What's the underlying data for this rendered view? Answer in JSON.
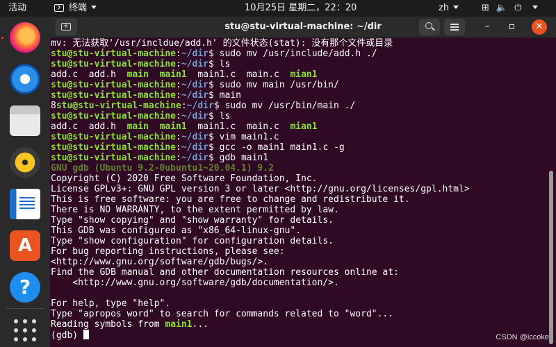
{
  "topbar": {
    "activities": "活动",
    "app_menu": "终端",
    "clock": "10月25日 星期二，22：20",
    "language": "zh",
    "icons": [
      "network-icon",
      "volume-icon",
      "power-icon"
    ]
  },
  "dock": {
    "apps": [
      "firefox",
      "thunderbird",
      "files",
      "rhythmbox",
      "libreoffice-writer",
      "ubuntu-software",
      "help",
      "show-applications"
    ],
    "software_glyph": "A",
    "help_glyph": "?"
  },
  "window": {
    "title": "stu@stu-virtual-machine: ~/dir",
    "new_tab": "+",
    "minimize": "–",
    "close": "✕"
  },
  "terminal": {
    "user_host": "stu@stu-virtual-machine",
    "colon": ":",
    "path": "~/dir",
    "lines": [
      {
        "type": "out",
        "text": "mv: 无法获取'/usr/incldue/add.h' 的文件状态(stat): 没有那个文件或目录"
      },
      {
        "type": "cmd",
        "pre": "",
        "cmd": " sudo mv /usr/include/add.h ./"
      },
      {
        "type": "cmd",
        "pre": "",
        "cmd": " ls"
      },
      {
        "type": "ls",
        "files": [
          {
            "t": "add.c",
            "x": false
          },
          {
            "t": "add.h",
            "x": false
          },
          {
            "t": "main",
            "x": true
          },
          {
            "t": "main1",
            "x": true
          },
          {
            "t": "main1.c",
            "x": false
          },
          {
            "t": "main.c",
            "x": false
          },
          {
            "t": "mian1",
            "x": true
          }
        ]
      },
      {
        "type": "cmd",
        "pre": "",
        "cmd": " sudo mv main /usr/bin/"
      },
      {
        "type": "cmd",
        "pre": "",
        "cmd": " main"
      },
      {
        "type": "cmd",
        "pre": "8",
        "cmd": " sudo mv /usr/bin/main ./"
      },
      {
        "type": "cmd",
        "pre": "",
        "cmd": " ls"
      },
      {
        "type": "ls",
        "files": [
          {
            "t": "add.c",
            "x": false
          },
          {
            "t": "add.h",
            "x": false
          },
          {
            "t": "main",
            "x": true
          },
          {
            "t": "main1",
            "x": true
          },
          {
            "t": "main1.c",
            "x": false
          },
          {
            "t": "main.c",
            "x": false
          },
          {
            "t": "mian1",
            "x": true
          }
        ]
      },
      {
        "type": "cmd",
        "pre": "",
        "cmd": " vim main1.c"
      },
      {
        "type": "cmd",
        "pre": "",
        "cmd": " gcc -o main1 main1.c -g"
      },
      {
        "type": "cmd",
        "pre": "",
        "cmd": " gdb main1"
      },
      {
        "type": "gdbver",
        "text": "GNU gdb (Ubuntu 9.2-0ubuntu1~20.04.1) 9.2"
      },
      {
        "type": "out",
        "text": "Copyright (C) 2020 Free Software Foundation, Inc."
      },
      {
        "type": "out",
        "text": "License GPLv3+: GNU GPL version 3 or later <http://gnu.org/licenses/gpl.html>"
      },
      {
        "type": "out",
        "text": "This is free software: you are free to change and redistribute it."
      },
      {
        "type": "out",
        "text": "There is NO WARRANTY, to the extent permitted by law."
      },
      {
        "type": "out",
        "text": "Type \"show copying\" and \"show warranty\" for details."
      },
      {
        "type": "out",
        "text": "This GDB was configured as \"x86_64-linux-gnu\"."
      },
      {
        "type": "out",
        "text": "Type \"show configuration\" for configuration details."
      },
      {
        "type": "out",
        "text": "For bug reporting instructions, please see:"
      },
      {
        "type": "out",
        "text": "<http://www.gnu.org/software/gdb/bugs/>."
      },
      {
        "type": "out",
        "text": "Find the GDB manual and other documentation resources online at:"
      },
      {
        "type": "out",
        "text": "    <http://www.gnu.org/software/gdb/documentation/>."
      },
      {
        "type": "out",
        "text": ""
      },
      {
        "type": "out",
        "text": "For help, type \"help\"."
      },
      {
        "type": "out",
        "text": "Type \"apropos word\" to search for commands related to \"word\"..."
      },
      {
        "type": "reading",
        "pre": "Reading symbols from ",
        "file": "main1",
        "post": "..."
      },
      {
        "type": "gdbprompt",
        "text": "(gdb) "
      }
    ]
  },
  "watermark": "CSDN @iccoke",
  "colors": {
    "terminal_bg": "#300a24",
    "prompt_green": "#8ae234",
    "path_blue": "#729fcf",
    "accent_orange": "#e95420"
  }
}
